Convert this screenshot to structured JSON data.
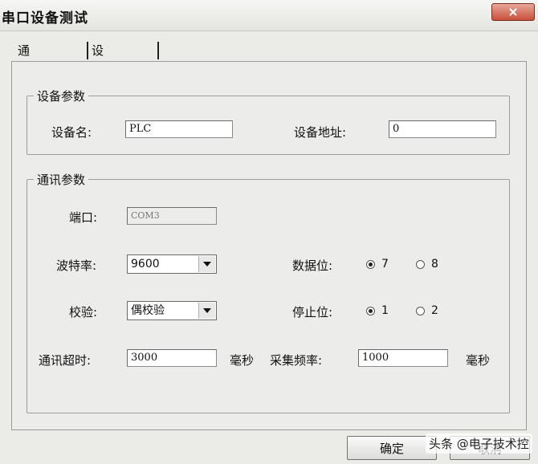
{
  "window": {
    "title": "串口设备测试"
  },
  "tabs": [
    {
      "label": "通讯参数",
      "active": true
    },
    {
      "label": "设备测试",
      "active": false
    }
  ],
  "device_group": {
    "legend": "设备参数",
    "name_label": "设备名:",
    "name_value": "PLC",
    "address_label": "设备地址:",
    "address_value": "0"
  },
  "comm_group": {
    "legend": "通讯参数",
    "port_label": "端口:",
    "port_value": "COM3",
    "baud_label": "波特率:",
    "baud_value": "9600",
    "parity_label": "校验:",
    "parity_value": "偶校验",
    "databits_label": "数据位:",
    "databits_options": [
      "7",
      "8"
    ],
    "databits_selected": "7",
    "stopbits_label": "停止位:",
    "stopbits_options": [
      "1",
      "2"
    ],
    "stopbits_selected": "1",
    "timeout_label": "通讯超时:",
    "timeout_value": "3000",
    "timeout_unit": "毫秒",
    "freq_label": "采集频率:",
    "freq_value": "1000",
    "freq_unit": "毫秒"
  },
  "buttons": {
    "ok": "确定",
    "cancel": "取消"
  },
  "watermark": "头条 @电子技术控"
}
